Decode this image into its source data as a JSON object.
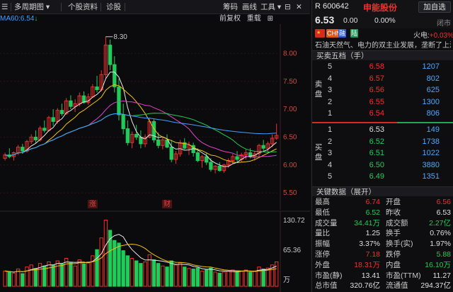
{
  "toolbar": {
    "multi_period": "多周期图",
    "profile": "个股资料",
    "diagnose": "诊股",
    "chips": "筹码",
    "draw": "画线",
    "tools": "工具"
  },
  "chart_header": {
    "ma_label": "MA60:6.54",
    "ma_arrow": "↓",
    "adjust": "前复权",
    "overlay": "重载"
  },
  "chart_markers": {
    "high_label": "8.30",
    "event_up": "涨",
    "event_fin": "财"
  },
  "chart_data": {
    "type": "candlestick",
    "price_axis": {
      "ticks": [
        "8.00",
        "7.50",
        "7.00",
        "6.50",
        "6.00",
        "5.50"
      ],
      "min": 5.4,
      "max": 8.45
    },
    "volume_axis": {
      "ticks": [
        "130.72",
        "65.36",
        "万"
      ],
      "max": 130.72
    },
    "candles": [
      [
        6.12,
        6.22,
        6.08,
        6.18
      ],
      [
        6.18,
        6.3,
        6.12,
        6.15
      ],
      [
        6.15,
        6.24,
        6.08,
        6.22
      ],
      [
        6.22,
        6.36,
        6.18,
        6.32
      ],
      [
        6.32,
        6.38,
        6.2,
        6.25
      ],
      [
        6.25,
        6.45,
        6.22,
        6.42
      ],
      [
        6.42,
        6.55,
        6.38,
        6.5
      ],
      [
        6.5,
        6.62,
        6.4,
        6.45
      ],
      [
        6.45,
        6.7,
        6.42,
        6.66
      ],
      [
        6.66,
        6.8,
        6.58,
        6.62
      ],
      [
        6.62,
        6.88,
        6.6,
        6.85
      ],
      [
        6.85,
        7.0,
        6.7,
        6.78
      ],
      [
        6.78,
        7.02,
        6.74,
        6.98
      ],
      [
        6.98,
        7.1,
        6.88,
        6.92
      ],
      [
        6.92,
        7.2,
        6.9,
        7.15
      ],
      [
        7.15,
        7.25,
        7.0,
        7.05
      ],
      [
        7.05,
        7.18,
        6.95,
        7.1
      ],
      [
        7.1,
        7.3,
        7.05,
        7.24
      ],
      [
        7.24,
        7.32,
        7.1,
        7.12
      ],
      [
        7.12,
        7.28,
        7.08,
        7.22
      ],
      [
        7.22,
        7.45,
        7.2,
        7.4
      ],
      [
        7.4,
        7.6,
        7.3,
        7.35
      ],
      [
        7.35,
        7.7,
        7.32,
        7.62
      ],
      [
        7.62,
        8.3,
        7.55,
        8.15
      ],
      [
        8.15,
        8.25,
        7.7,
        7.8
      ],
      [
        7.8,
        7.95,
        7.3,
        7.4
      ],
      [
        7.4,
        7.55,
        6.8,
        6.9
      ],
      [
        6.9,
        7.1,
        6.55,
        6.65
      ],
      [
        6.65,
        6.8,
        6.35,
        6.4
      ],
      [
        6.4,
        6.6,
        6.3,
        6.55
      ],
      [
        6.55,
        6.72,
        6.45,
        6.5
      ],
      [
        6.5,
        6.62,
        6.3,
        6.38
      ],
      [
        6.38,
        6.55,
        6.32,
        6.5
      ],
      [
        6.5,
        6.85,
        6.48,
        6.78
      ],
      [
        6.78,
        6.82,
        6.4,
        6.45
      ],
      [
        6.45,
        6.58,
        6.3,
        6.35
      ],
      [
        6.35,
        6.5,
        6.28,
        6.45
      ],
      [
        6.45,
        6.55,
        6.3,
        6.32
      ],
      [
        6.32,
        6.45,
        6.05,
        6.1
      ],
      [
        6.1,
        6.25,
        6.02,
        6.2
      ],
      [
        6.2,
        6.45,
        6.15,
        6.4
      ],
      [
        6.4,
        6.48,
        6.28,
        6.3
      ],
      [
        6.3,
        6.42,
        6.18,
        6.35
      ],
      [
        6.35,
        6.4,
        6.15,
        6.22
      ],
      [
        6.22,
        6.3,
        6.05,
        6.08
      ],
      [
        6.08,
        6.18,
        5.95,
        6.15
      ],
      [
        6.15,
        6.22,
        6.0,
        6.05
      ],
      [
        6.05,
        6.12,
        5.88,
        5.92
      ],
      [
        5.92,
        6.0,
        5.85,
        5.98
      ],
      [
        5.98,
        6.05,
        5.88,
        5.9
      ],
      [
        5.9,
        6.02,
        5.86,
        6.0
      ],
      [
        6.0,
        6.12,
        5.95,
        6.08
      ],
      [
        6.08,
        6.2,
        6.02,
        6.15
      ],
      [
        6.15,
        6.25,
        6.05,
        6.1
      ],
      [
        6.1,
        6.22,
        6.05,
        6.18
      ],
      [
        6.18,
        6.28,
        6.1,
        6.22
      ],
      [
        6.22,
        6.3,
        6.12,
        6.15
      ],
      [
        6.15,
        6.25,
        6.08,
        6.2
      ],
      [
        6.2,
        6.38,
        6.15,
        6.35
      ],
      [
        6.35,
        6.45,
        6.25,
        6.3
      ],
      [
        6.3,
        6.42,
        6.22,
        6.38
      ],
      [
        6.38,
        6.55,
        6.32,
        6.48
      ],
      [
        6.48,
        6.74,
        6.45,
        6.53
      ]
    ],
    "volumes": [
      30,
      28,
      26,
      34,
      25,
      38,
      42,
      35,
      45,
      40,
      48,
      42,
      50,
      44,
      55,
      46,
      40,
      52,
      44,
      48,
      60,
      72,
      95,
      130,
      110,
      90,
      85,
      70,
      60,
      55,
      50,
      45,
      48,
      62,
      52,
      45,
      40,
      38,
      50,
      42,
      46,
      38,
      35,
      34,
      36,
      30,
      32,
      36,
      28,
      26,
      28,
      30,
      32,
      28,
      30,
      32,
      28,
      30,
      38,
      34,
      36,
      42,
      48
    ]
  },
  "quote": {
    "code": "R 600642",
    "name": "申能股份",
    "add_button": "加自选",
    "price": "6.53",
    "change": "0.00",
    "change_pct": "0.00%",
    "status": "闭市",
    "tag_chn": "CHN",
    "tag_rong": "融",
    "tag_lu": "陆",
    "hot_label": "火电:",
    "hot_value": "+0.03%",
    "description": "石油天然气、电力的双主业发展，垄断了上海..."
  },
  "orderbook": {
    "title": "买卖五档（手）",
    "sell_side_label": "卖盘",
    "buy_side_label": "买盘",
    "sell": [
      {
        "level": "5",
        "price": "6.58",
        "qty": "1207"
      },
      {
        "level": "4",
        "price": "6.57",
        "qty": "802"
      },
      {
        "level": "3",
        "price": "6.56",
        "qty": "625"
      },
      {
        "level": "2",
        "price": "6.55",
        "qty": "1300"
      },
      {
        "level": "1",
        "price": "6.54",
        "qty": "806"
      }
    ],
    "buy": [
      {
        "level": "1",
        "price": "6.53",
        "qty": "149"
      },
      {
        "level": "2",
        "price": "6.52",
        "qty": "1738"
      },
      {
        "level": "3",
        "price": "6.51",
        "qty": "1022"
      },
      {
        "level": "4",
        "price": "6.50",
        "qty": "3880"
      },
      {
        "level": "5",
        "price": "6.49",
        "qty": "1351"
      }
    ]
  },
  "stats": {
    "title": "关键数据（展开）",
    "rows": [
      {
        "k1": "最高",
        "v1": "6.74",
        "c1": "up",
        "k2": "开盘",
        "v2": "6.56",
        "c2": "up"
      },
      {
        "k1": "最低",
        "v1": "6.52",
        "c1": "down",
        "k2": "昨收",
        "v2": "6.53",
        "c2": "neutral"
      },
      {
        "k1": "成交量",
        "v1": "34.41万",
        "c1": "down",
        "k2": "成交额",
        "v2": "2.27亿",
        "c2": "down"
      },
      {
        "k1": "量比",
        "v1": "1.25",
        "c1": "neutral",
        "k2": "换手",
        "v2": "0.76%",
        "c2": "neutral"
      },
      {
        "k1": "振幅",
        "v1": "3.37%",
        "c1": "neutral",
        "k2": "换手(实)",
        "v2": "1.97%",
        "c2": "neutral"
      },
      {
        "k1": "涨停",
        "v1": "7.18",
        "c1": "up",
        "k2": "跌停",
        "v2": "5.88",
        "c2": "down"
      },
      {
        "k1": "外盘",
        "v1": "18.31万",
        "c1": "up",
        "k2": "内盘",
        "v2": "16.10万",
        "c2": "down"
      },
      {
        "k1": "市盈(静)",
        "v1": "13.41",
        "c1": "neutral",
        "k2": "市盈(TTM)",
        "v2": "11.27",
        "c2": "neutral"
      },
      {
        "k1": "总市值",
        "v1": "320.76亿",
        "c1": "neutral",
        "k2": "流通值",
        "v2": "294.37亿",
        "c2": "neutral"
      }
    ]
  },
  "colors": {
    "up": "#f0302c",
    "down": "#1fcc5a",
    "volume_tint": "#3fa0ff"
  }
}
